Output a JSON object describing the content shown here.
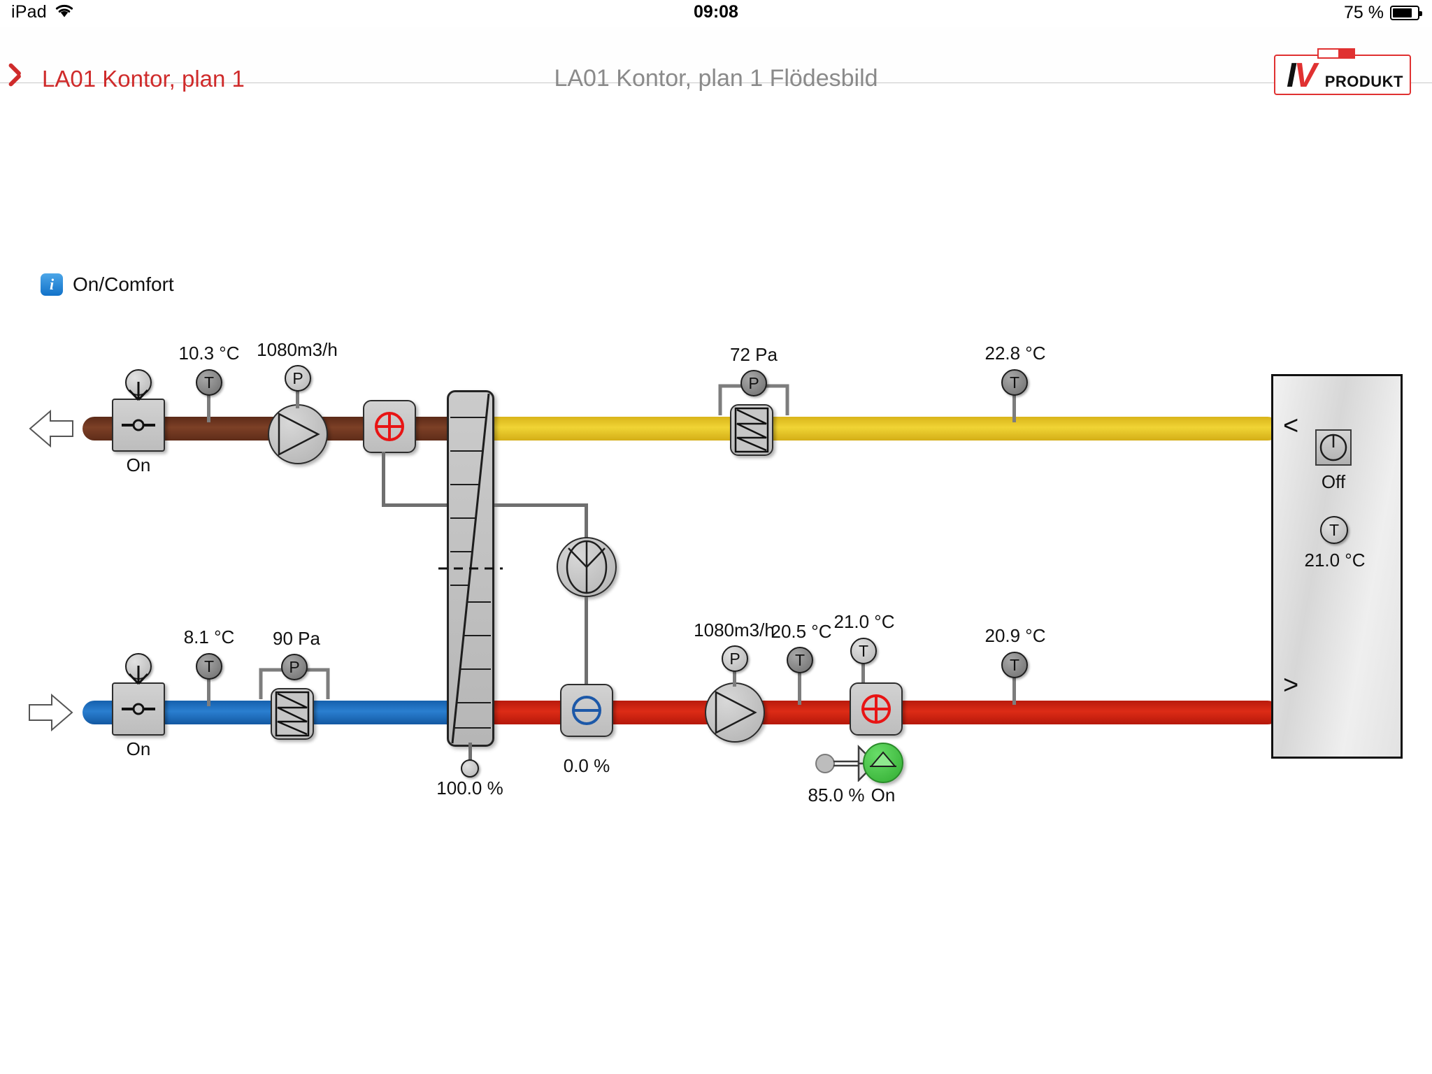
{
  "statusbar": {
    "device": "iPad",
    "wifi_icon": "wifi-icon",
    "time": "09:08",
    "battery_percent": "75 %",
    "battery_icon": "battery-icon"
  },
  "navbar": {
    "back_icon": "chevron-left-icon",
    "back_label": "LA01 Kontor, plan 1",
    "title": "LA01 Kontor, plan 1 Flödesbild",
    "accent_color": "#cf2b2b",
    "title_color": "#8a8a8a"
  },
  "logo": {
    "mark": "IV",
    "word": "PRODUKT",
    "color": "#e03131"
  },
  "mode": {
    "info_icon": "info-icon",
    "label": "On/Comfort"
  },
  "colors": {
    "duct_extract": "#7d4026",
    "duct_exhaust": "#e8c51e",
    "duct_outdoor": "#2a7fd0",
    "duct_supply": "#d32010",
    "heating": "#e81414",
    "cooling": "#1c58a8",
    "pump_on": "#3fbe3f"
  },
  "extract_air": {
    "damper": {
      "icon": "damper-icon",
      "state": "On"
    },
    "temp_sensor": {
      "icon": "temperature-sensor-icon",
      "value": "10.3 °C"
    },
    "fan": {
      "icon": "fan-icon"
    },
    "flow_sensor": {
      "icon": "pressure-sensor-icon",
      "value": "1080m3/h"
    },
    "heating_coil": {
      "icon": "heating-coil-icon",
      "symbol": "⊕"
    }
  },
  "exhaust_air": {
    "filter": {
      "icon": "filter-icon"
    },
    "pressure_sensor": {
      "icon": "pressure-sensor-icon",
      "value": "72 Pa"
    },
    "temp_sensor": {
      "icon": "temperature-sensor-icon",
      "value": "22.8 °C"
    }
  },
  "outdoor_air": {
    "damper": {
      "icon": "damper-icon",
      "state": "On"
    },
    "temp_sensor": {
      "icon": "temperature-sensor-icon",
      "value": "8.1 °C"
    },
    "filter": {
      "icon": "filter-icon"
    },
    "pressure_sensor": {
      "icon": "pressure-sensor-icon",
      "value": "90 Pa"
    }
  },
  "heat_exchanger": {
    "icon": "plate-heat-exchanger-icon",
    "value": "100.0 %"
  },
  "cooling_unit": {
    "icon": "cooling-coil-icon",
    "symbol": "⊖",
    "value": "0.0 %"
  },
  "supply_air": {
    "fan": {
      "icon": "fan-icon"
    },
    "flow_sensor": {
      "icon": "pressure-sensor-icon",
      "value": "1080m3/h"
    },
    "temp_sensor_1": {
      "icon": "temperature-sensor-icon",
      "value": "20.5 °C"
    },
    "temp_sensor_2": {
      "icon": "temperature-sensor-icon",
      "value": "21.0 °C"
    },
    "heating_coil": {
      "icon": "heating-coil-icon",
      "symbol": "⊕"
    },
    "valve": {
      "icon": "valve-icon",
      "value": "85.0 %"
    },
    "pump": {
      "icon": "pump-icon",
      "state": "On"
    },
    "temp_sensor_3": {
      "icon": "temperature-sensor-icon",
      "value": "20.9 °C"
    }
  },
  "room": {
    "schedule": {
      "icon": "timer-icon",
      "state": "Off"
    },
    "temp_sensor": {
      "icon": "temperature-sensor-icon",
      "value": "21.0 °C"
    },
    "inlet_chevron": "<",
    "outlet_chevron": ">"
  }
}
